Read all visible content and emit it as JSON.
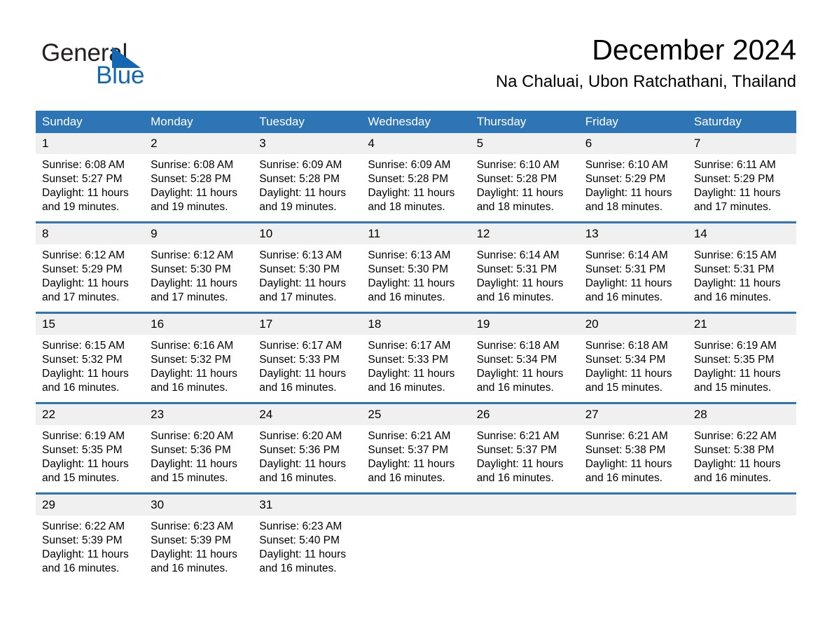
{
  "brand": {
    "name_part1": "General",
    "name_part2": "Blue",
    "accent_color": "#1268b3",
    "triangle_icon": "triangle-icon"
  },
  "header": {
    "title": "December 2024",
    "subtitle": "Na Chaluai, Ubon Ratchathani, Thailand"
  },
  "calendar": {
    "header_bg": "#2e75b6",
    "daynum_bg": "#f0f0f0",
    "weekdays": [
      "Sunday",
      "Monday",
      "Tuesday",
      "Wednesday",
      "Thursday",
      "Friday",
      "Saturday"
    ],
    "weeks": [
      [
        {
          "day": "1",
          "sunrise": "Sunrise: 6:08 AM",
          "sunset": "Sunset: 5:27 PM",
          "daylight": "Daylight: 11 hours and 19 minutes."
        },
        {
          "day": "2",
          "sunrise": "Sunrise: 6:08 AM",
          "sunset": "Sunset: 5:28 PM",
          "daylight": "Daylight: 11 hours and 19 minutes."
        },
        {
          "day": "3",
          "sunrise": "Sunrise: 6:09 AM",
          "sunset": "Sunset: 5:28 PM",
          "daylight": "Daylight: 11 hours and 19 minutes."
        },
        {
          "day": "4",
          "sunrise": "Sunrise: 6:09 AM",
          "sunset": "Sunset: 5:28 PM",
          "daylight": "Daylight: 11 hours and 18 minutes."
        },
        {
          "day": "5",
          "sunrise": "Sunrise: 6:10 AM",
          "sunset": "Sunset: 5:28 PM",
          "daylight": "Daylight: 11 hours and 18 minutes."
        },
        {
          "day": "6",
          "sunrise": "Sunrise: 6:10 AM",
          "sunset": "Sunset: 5:29 PM",
          "daylight": "Daylight: 11 hours and 18 minutes."
        },
        {
          "day": "7",
          "sunrise": "Sunrise: 6:11 AM",
          "sunset": "Sunset: 5:29 PM",
          "daylight": "Daylight: 11 hours and 17 minutes."
        }
      ],
      [
        {
          "day": "8",
          "sunrise": "Sunrise: 6:12 AM",
          "sunset": "Sunset: 5:29 PM",
          "daylight": "Daylight: 11 hours and 17 minutes."
        },
        {
          "day": "9",
          "sunrise": "Sunrise: 6:12 AM",
          "sunset": "Sunset: 5:30 PM",
          "daylight": "Daylight: 11 hours and 17 minutes."
        },
        {
          "day": "10",
          "sunrise": "Sunrise: 6:13 AM",
          "sunset": "Sunset: 5:30 PM",
          "daylight": "Daylight: 11 hours and 17 minutes."
        },
        {
          "day": "11",
          "sunrise": "Sunrise: 6:13 AM",
          "sunset": "Sunset: 5:30 PM",
          "daylight": "Daylight: 11 hours and 16 minutes."
        },
        {
          "day": "12",
          "sunrise": "Sunrise: 6:14 AM",
          "sunset": "Sunset: 5:31 PM",
          "daylight": "Daylight: 11 hours and 16 minutes."
        },
        {
          "day": "13",
          "sunrise": "Sunrise: 6:14 AM",
          "sunset": "Sunset: 5:31 PM",
          "daylight": "Daylight: 11 hours and 16 minutes."
        },
        {
          "day": "14",
          "sunrise": "Sunrise: 6:15 AM",
          "sunset": "Sunset: 5:31 PM",
          "daylight": "Daylight: 11 hours and 16 minutes."
        }
      ],
      [
        {
          "day": "15",
          "sunrise": "Sunrise: 6:15 AM",
          "sunset": "Sunset: 5:32 PM",
          "daylight": "Daylight: 11 hours and 16 minutes."
        },
        {
          "day": "16",
          "sunrise": "Sunrise: 6:16 AM",
          "sunset": "Sunset: 5:32 PM",
          "daylight": "Daylight: 11 hours and 16 minutes."
        },
        {
          "day": "17",
          "sunrise": "Sunrise: 6:17 AM",
          "sunset": "Sunset: 5:33 PM",
          "daylight": "Daylight: 11 hours and 16 minutes."
        },
        {
          "day": "18",
          "sunrise": "Sunrise: 6:17 AM",
          "sunset": "Sunset: 5:33 PM",
          "daylight": "Daylight: 11 hours and 16 minutes."
        },
        {
          "day": "19",
          "sunrise": "Sunrise: 6:18 AM",
          "sunset": "Sunset: 5:34 PM",
          "daylight": "Daylight: 11 hours and 16 minutes."
        },
        {
          "day": "20",
          "sunrise": "Sunrise: 6:18 AM",
          "sunset": "Sunset: 5:34 PM",
          "daylight": "Daylight: 11 hours and 15 minutes."
        },
        {
          "day": "21",
          "sunrise": "Sunrise: 6:19 AM",
          "sunset": "Sunset: 5:35 PM",
          "daylight": "Daylight: 11 hours and 15 minutes."
        }
      ],
      [
        {
          "day": "22",
          "sunrise": "Sunrise: 6:19 AM",
          "sunset": "Sunset: 5:35 PM",
          "daylight": "Daylight: 11 hours and 15 minutes."
        },
        {
          "day": "23",
          "sunrise": "Sunrise: 6:20 AM",
          "sunset": "Sunset: 5:36 PM",
          "daylight": "Daylight: 11 hours and 15 minutes."
        },
        {
          "day": "24",
          "sunrise": "Sunrise: 6:20 AM",
          "sunset": "Sunset: 5:36 PM",
          "daylight": "Daylight: 11 hours and 16 minutes."
        },
        {
          "day": "25",
          "sunrise": "Sunrise: 6:21 AM",
          "sunset": "Sunset: 5:37 PM",
          "daylight": "Daylight: 11 hours and 16 minutes."
        },
        {
          "day": "26",
          "sunrise": "Sunrise: 6:21 AM",
          "sunset": "Sunset: 5:37 PM",
          "daylight": "Daylight: 11 hours and 16 minutes."
        },
        {
          "day": "27",
          "sunrise": "Sunrise: 6:21 AM",
          "sunset": "Sunset: 5:38 PM",
          "daylight": "Daylight: 11 hours and 16 minutes."
        },
        {
          "day": "28",
          "sunrise": "Sunrise: 6:22 AM",
          "sunset": "Sunset: 5:38 PM",
          "daylight": "Daylight: 11 hours and 16 minutes."
        }
      ],
      [
        {
          "day": "29",
          "sunrise": "Sunrise: 6:22 AM",
          "sunset": "Sunset: 5:39 PM",
          "daylight": "Daylight: 11 hours and 16 minutes."
        },
        {
          "day": "30",
          "sunrise": "Sunrise: 6:23 AM",
          "sunset": "Sunset: 5:39 PM",
          "daylight": "Daylight: 11 hours and 16 minutes."
        },
        {
          "day": "31",
          "sunrise": "Sunrise: 6:23 AM",
          "sunset": "Sunset: 5:40 PM",
          "daylight": "Daylight: 11 hours and 16 minutes."
        },
        {
          "day": "",
          "sunrise": "",
          "sunset": "",
          "daylight": ""
        },
        {
          "day": "",
          "sunrise": "",
          "sunset": "",
          "daylight": ""
        },
        {
          "day": "",
          "sunrise": "",
          "sunset": "",
          "daylight": ""
        },
        {
          "day": "",
          "sunrise": "",
          "sunset": "",
          "daylight": ""
        }
      ]
    ]
  }
}
